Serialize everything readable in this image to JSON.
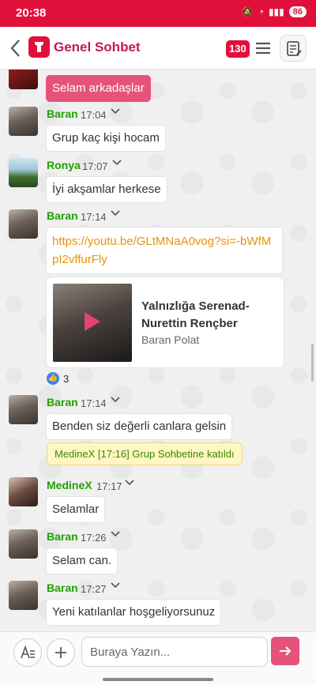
{
  "status_bar": {
    "time": "20:38",
    "battery": "86"
  },
  "header": {
    "title": "Genel Sohbet",
    "member_count": "130"
  },
  "messages": [
    {
      "sender": "",
      "time": "",
      "text": "Selam arkadaşlar"
    },
    {
      "sender": "Baran",
      "time": "17:04",
      "text": "Grup kaç kişi hocam"
    },
    {
      "sender": "Ronya",
      "time": "17:07",
      "text": "İyi akşamlar herkese"
    },
    {
      "sender": "Baran",
      "time": "17:14",
      "text": "https://youtu.be/GLtMNaA0vog?si=-bWfMpI2vffurFly"
    },
    {
      "sender": "Baran",
      "time": "17:14",
      "text": "Benden siz değerli canlara gelsin"
    },
    {
      "sender": "MedineX",
      "time": "17:17",
      "text": "Selamlar"
    },
    {
      "sender": "Baran",
      "time": "17:26",
      "text": "Selam can."
    },
    {
      "sender": "Baran",
      "time": "17:27",
      "text": "Yeni katılanlar hoşgeliyorsunuz"
    }
  ],
  "link_preview": {
    "title": "Yalnızlığa Serenad-Nurettin Rençber",
    "author": "Baran Polat"
  },
  "reactions": {
    "count": "3"
  },
  "system_message": "MedineX [17:16] Grup Sohbetine katıldı",
  "composer": {
    "placeholder": "Buraya Yazın..."
  },
  "icons": {
    "back": "chevron-left-icon",
    "menu": "hamburger-menu-icon",
    "notes": "notes-edit-icon",
    "format": "text-format-icon",
    "attach": "plus-icon",
    "send": "arrow-right-icon",
    "like": "thumbs-up-icon"
  },
  "colors": {
    "accent": "#e0103a",
    "sender_name": "#22a000",
    "link": "#e8920f",
    "pink_bubble": "#e5537a"
  }
}
